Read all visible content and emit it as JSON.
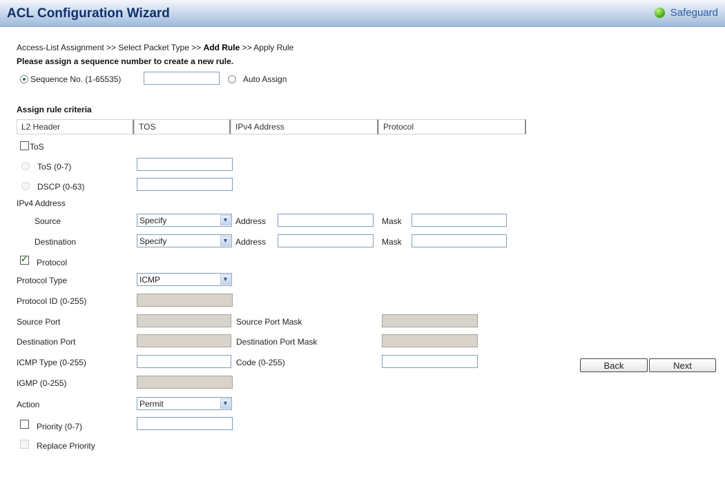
{
  "window": {
    "title": "ACL Configuration Wizard",
    "brand": "Safeguard"
  },
  "breadcrumb": {
    "step1": "Access-List Assignment >> Select Packet Type >> ",
    "step_current": "Add Rule",
    "step3": " >> Apply Rule"
  },
  "sequence": {
    "prompt": "Please assign a sequence number to create a new rule.",
    "seq_label": "Sequence No. (1-65535)",
    "seq_value": "",
    "auto_label": "Auto Assign"
  },
  "criteria": {
    "heading": "Assign rule criteria",
    "tabs": [
      "L2 Header",
      "TOS",
      "IPv4 Address",
      "Protocol"
    ]
  },
  "tos": {
    "checkbox_label": "ToS",
    "tos_label": "ToS  (0-7)",
    "tos_value": "",
    "dscp_label": "DSCP  (0-63)",
    "dscp_value": ""
  },
  "ipv4": {
    "heading": "IPv4 Address",
    "source_label": "Source",
    "source_select": "Specify",
    "source_address_label": "Address",
    "source_address": "",
    "source_mask_label": "Mask",
    "source_mask": "",
    "dest_label": "Destination",
    "dest_select": "Specify",
    "dest_address_label": "Address",
    "dest_address": "",
    "dest_mask_label": "Mask",
    "dest_mask": ""
  },
  "protocol": {
    "checkbox_label": "Protocol",
    "type_label": "Protocol Type",
    "type_value": "ICMP",
    "id_label": "Protocol ID (0-255)",
    "src_port_label": "Source Port",
    "src_port_mask_label": "Source Port Mask",
    "dst_port_label": "Destination Port",
    "dst_port_mask_label": "Destination Port Mask",
    "icmp_type_label": "ICMP Type (0-255)",
    "icmp_type_value": "",
    "code_label": "Code (0-255)",
    "code_value": "",
    "igmp_label": "IGMP (0-255)"
  },
  "action": {
    "label": "Action",
    "value": "Permit",
    "priority_label": "Priority  (0-7)",
    "priority_value": "",
    "replace_label": "Replace Priority"
  },
  "buttons": {
    "back": "Back",
    "next": "Next"
  },
  "colors": {
    "title_text": "#10306a",
    "accent": "#46b316",
    "disabled_field": "#d8d4cc"
  },
  "icons": {
    "brand": "green-dot-icon",
    "dropdown": "chevron-down-icon",
    "check": "checkmark-icon"
  }
}
